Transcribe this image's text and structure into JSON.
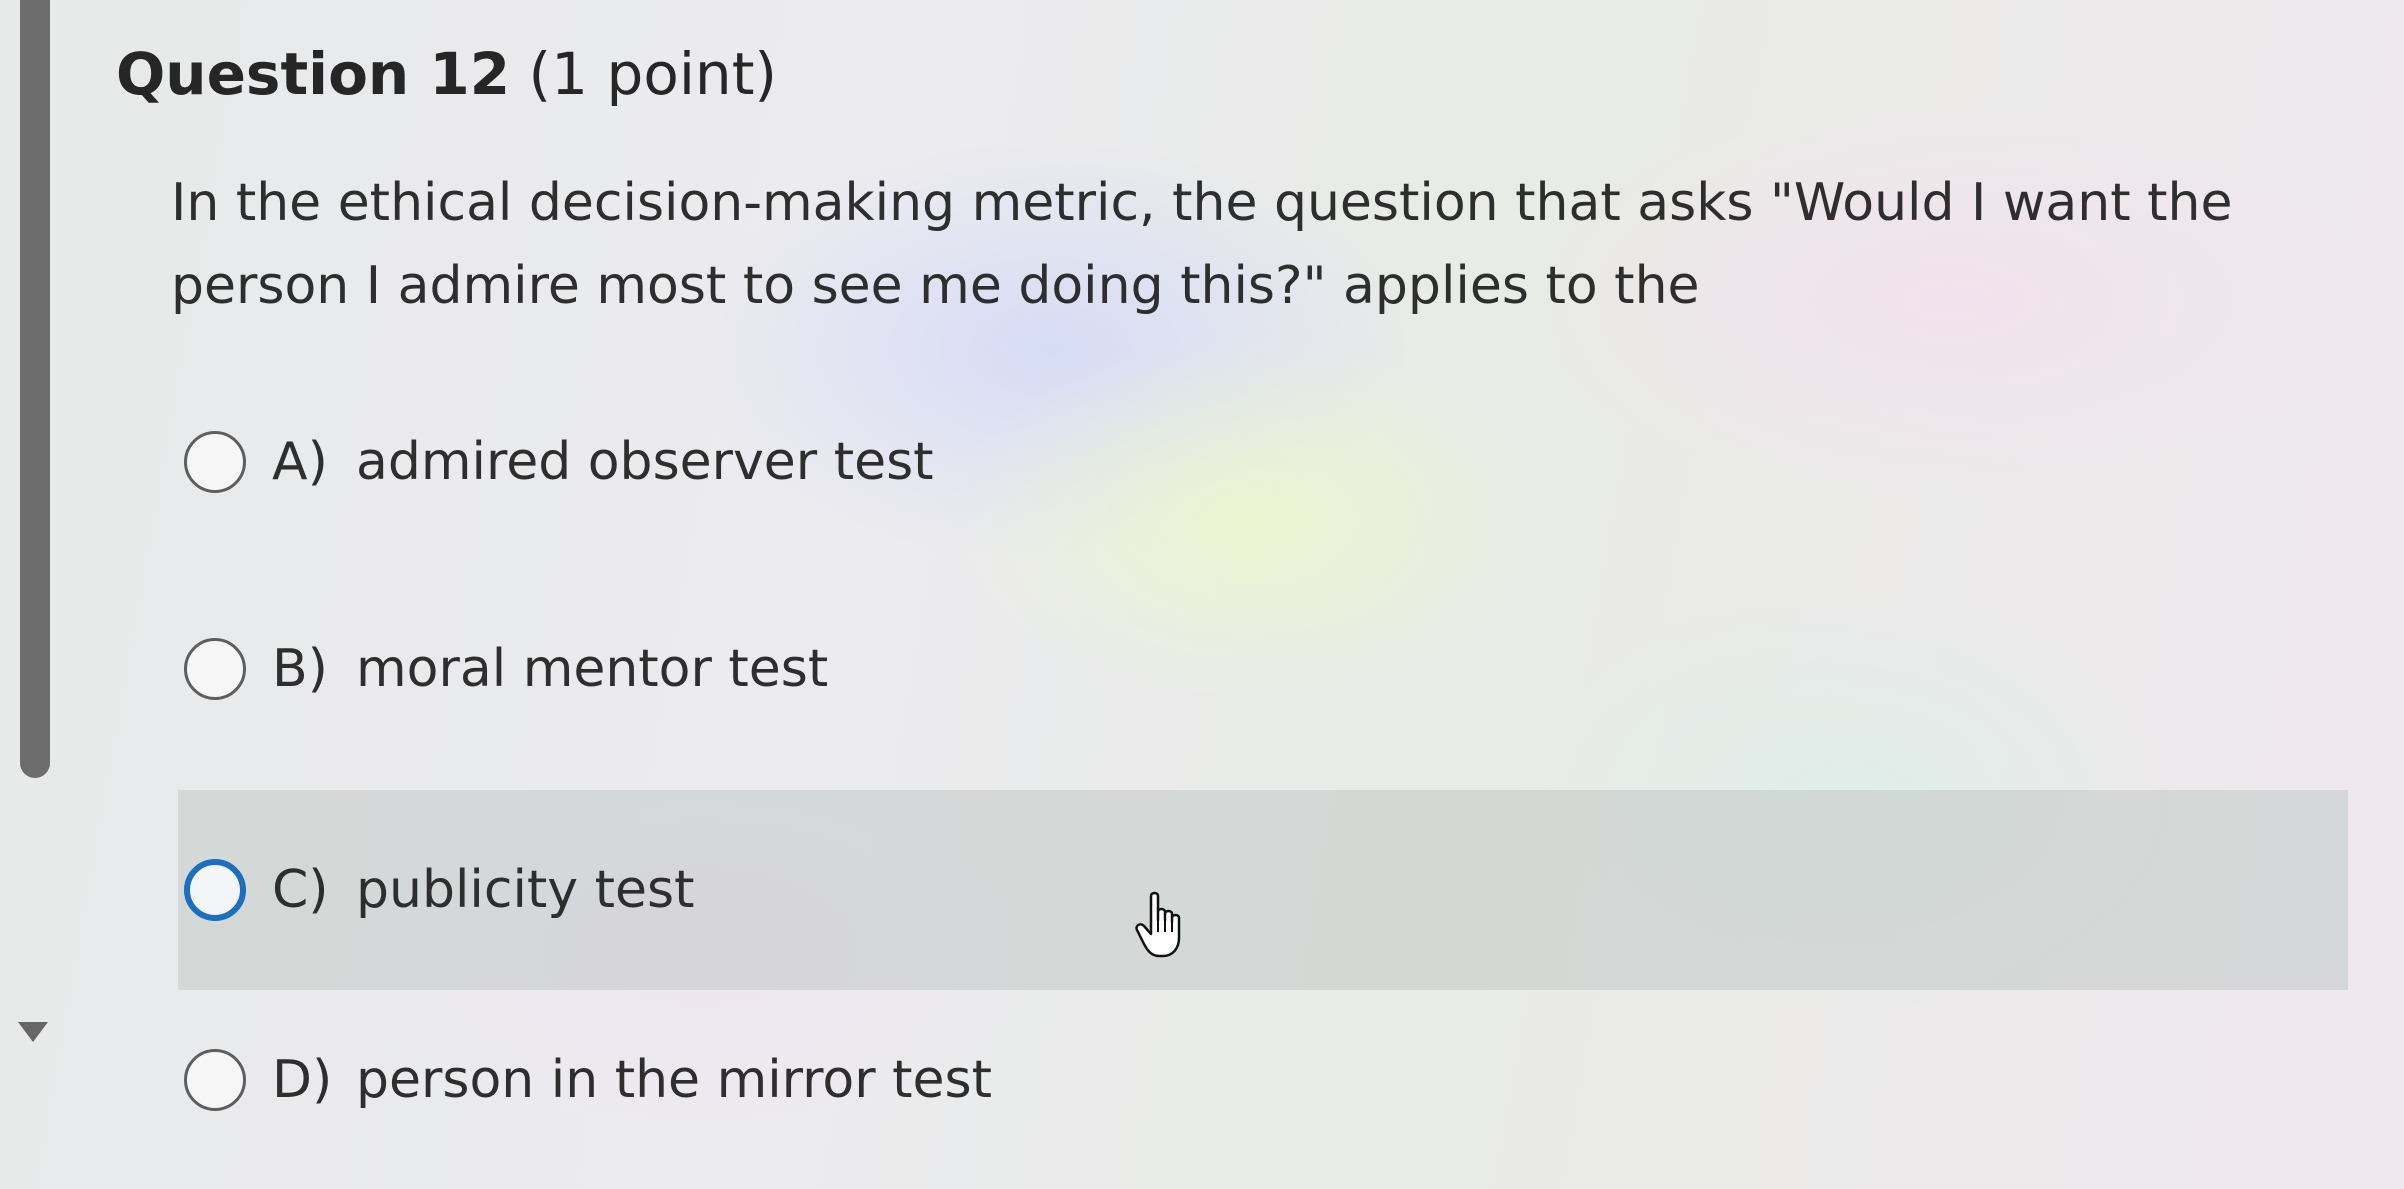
{
  "question": {
    "number_label": "Question 12",
    "points_label": "(1 point)",
    "prompt": "In the ethical decision-making metric, the question that asks \"Would I want the person I admire most to see me doing this?\" applies to the"
  },
  "options": [
    {
      "letter": "A)",
      "text": "admired observer test"
    },
    {
      "letter": "B)",
      "text": "moral mentor test"
    },
    {
      "letter": "C)",
      "text": "publicity test"
    },
    {
      "letter": "D)",
      "text": "person in the mirror test"
    }
  ],
  "hovered_option_index": 2,
  "cursor": "hand-pointer-icon",
  "colors": {
    "radio_focus": "#1a6fc0",
    "hover_row": "#c3c8c6",
    "text": "#2e2e2e"
  }
}
